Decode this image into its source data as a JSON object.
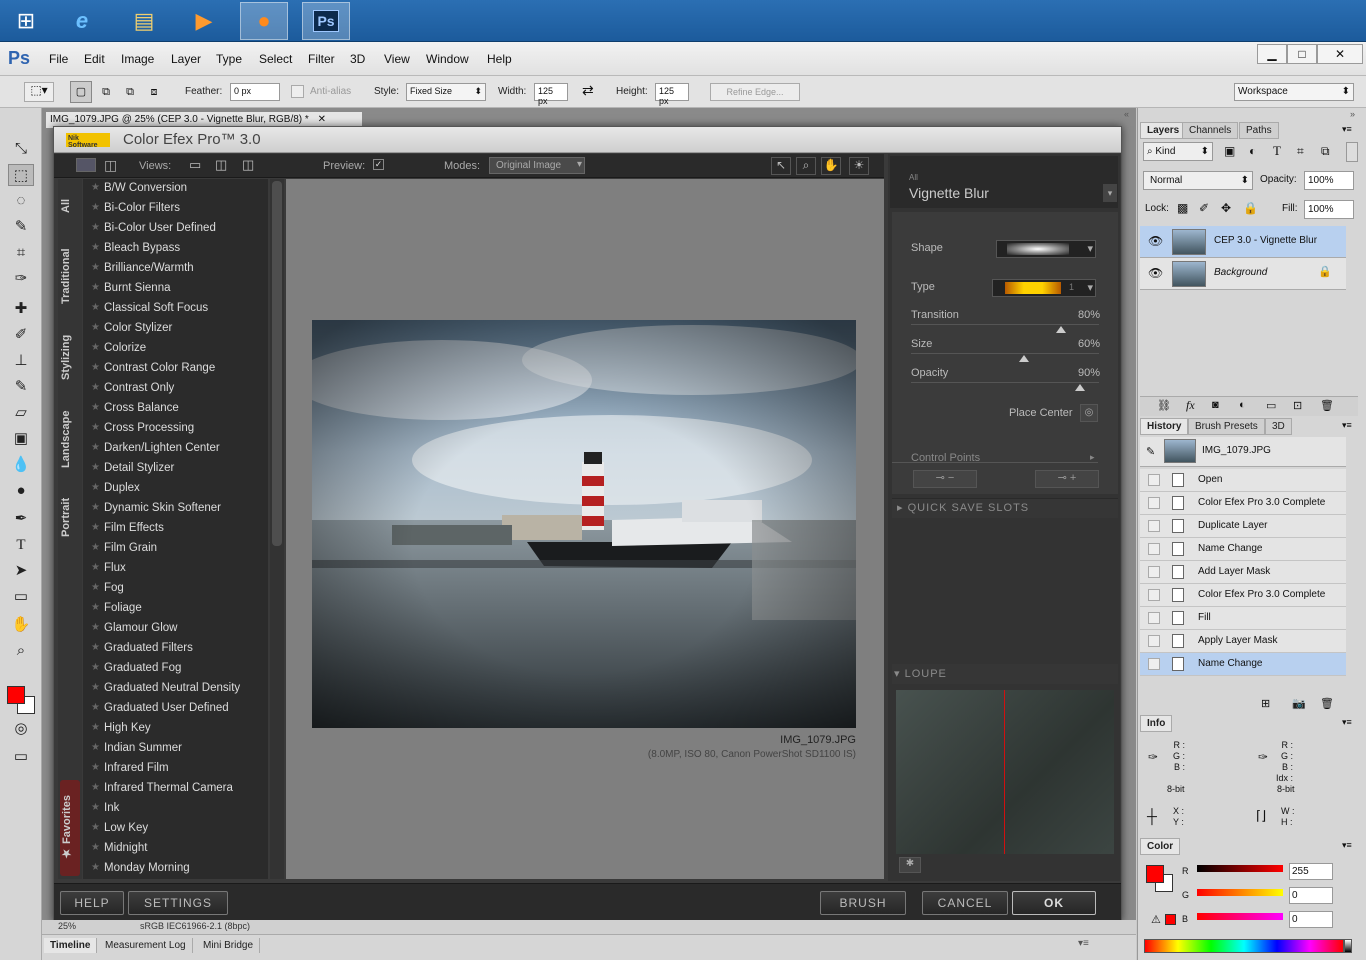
{
  "taskbar": {
    "icons": [
      "windows-start",
      "internet-explorer",
      "file-explorer",
      "media-player",
      "firefox",
      "photoshop"
    ]
  },
  "menubar": {
    "logo": "Ps",
    "items": [
      "File",
      "Edit",
      "Image",
      "Layer",
      "Type",
      "Select",
      "Filter",
      "3D",
      "View",
      "Window",
      "Help"
    ]
  },
  "options": {
    "feather_label": "Feather:",
    "feather_value": "0 px",
    "antialias_label": "Anti-alias",
    "style_label": "Style:",
    "style_value": "Fixed Size",
    "width_label": "Width:",
    "width_value": "125 px",
    "height_label": "Height:",
    "height_value": "125 px",
    "refine_edge": "Refine Edge...",
    "workspace": "Workspace"
  },
  "document": {
    "tab_title": "IMG_1079.JPG @ 25% (CEP 3.0 - Vignette Blur, RGB/8) *",
    "zoom": "25%",
    "profile": "sRGB IEC61966-2.1 (8bpc)"
  },
  "plugin": {
    "brand": "Nik Software",
    "title": "Color Efex Pro™ 3.0",
    "views_label": "Views:",
    "preview_label": "Preview:",
    "modes_label": "Modes:",
    "mode_value": "Original Image",
    "categories": [
      "All",
      "Traditional",
      "Stylizing",
      "Landscape",
      "Portrait",
      "Favorites"
    ],
    "filters": [
      "B/W Conversion",
      "Bi-Color Filters",
      "Bi-Color User Defined",
      "Bleach Bypass",
      "Brilliance/Warmth",
      "Burnt Sienna",
      "Classical Soft Focus",
      "Color Stylizer",
      "Colorize",
      "Contrast Color Range",
      "Contrast Only",
      "Cross Balance",
      "Cross Processing",
      "Darken/Lighten Center",
      "Detail Stylizer",
      "Duplex",
      "Dynamic Skin Softener",
      "Film Effects",
      "Film Grain",
      "Flux",
      "Fog",
      "Foliage",
      "Glamour Glow",
      "Graduated Filters",
      "Graduated Fog",
      "Graduated Neutral Density",
      "Graduated User Defined",
      "High Key",
      "Indian Summer",
      "Infrared Film",
      "Infrared Thermal Camera",
      "Ink",
      "Low Key",
      "Midnight",
      "Monday Morning"
    ],
    "image_name": "IMG_1079.JPG",
    "image_info": "(8.0MP, ISO 80, Canon PowerShot SD1100 IS)",
    "filter_group": "All",
    "filter_name": "Vignette Blur",
    "shape_label": "Shape",
    "type_label": "Type",
    "type_num": "1",
    "transition_label": "Transition",
    "transition_value": "80%",
    "size_label": "Size",
    "size_value": "60%",
    "opacity_label": "Opacity",
    "opacity_value": "90%",
    "sliders": {
      "transition": 0.8,
      "size": 0.6,
      "opacity": 0.9
    },
    "place_center": "Place Center",
    "control_points": "Control Points",
    "quick_save": "QUICK SAVE SLOTS",
    "loupe": "LOUPE",
    "buttons": {
      "help": "HELP",
      "settings": "SETTINGS",
      "brush": "BRUSH",
      "cancel": "CANCEL",
      "ok": "OK"
    }
  },
  "bottom_tabs": [
    "Timeline",
    "Measurement Log",
    "Mini Bridge"
  ],
  "layers_panel": {
    "tabs": [
      "Layers",
      "Channels",
      "Paths"
    ],
    "kind": "Kind",
    "blend": "Normal",
    "opacity_label": "Opacity:",
    "opacity_value": "100%",
    "lock_label": "Lock:",
    "fill_label": "Fill:",
    "fill_value": "100%",
    "layers": [
      {
        "name": "CEP 3.0 - Vignette Blur",
        "selected": true
      },
      {
        "name": "Background",
        "locked": true
      }
    ]
  },
  "history_panel": {
    "tabs": [
      "History",
      "Brush Presets",
      "3D"
    ],
    "snapshot": "IMG_1079.JPG",
    "steps": [
      "Open",
      "Color Efex Pro 3.0 Complete",
      "Duplicate Layer",
      "Name Change",
      "Add Layer Mask",
      "Color Efex Pro 3.0 Complete",
      "Fill",
      "Apply Layer Mask",
      "Name Change"
    ]
  },
  "info_panel": {
    "title": "Info",
    "bit_left": "8-bit",
    "bit_right": "8-bit",
    "r": "R :",
    "g": "G :",
    "b": "B :",
    "idx": "Idx :",
    "x": "X :",
    "y": "Y :",
    "w": "W :",
    "h": "H :"
  },
  "color_panel": {
    "title": "Color",
    "r_label": "R",
    "g_label": "G",
    "b_label": "B",
    "r": "255",
    "g": "0",
    "b": "0",
    "fg_color": "#ff0000"
  }
}
